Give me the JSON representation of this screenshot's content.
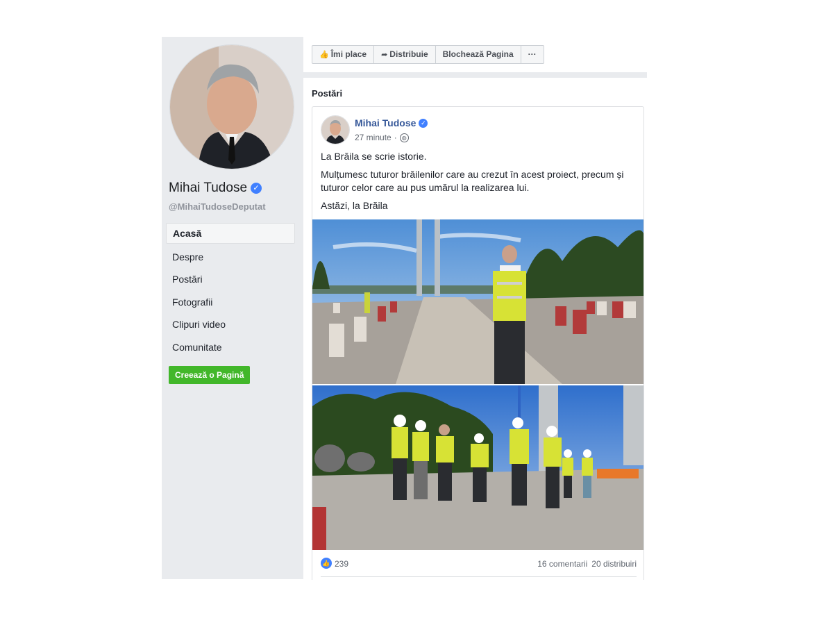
{
  "sidebar": {
    "page_name": "Mihai Tudose",
    "handle": "@MihaiTudoseDeputat",
    "nav": [
      {
        "label": "Acasă"
      },
      {
        "label": "Despre"
      },
      {
        "label": "Postări"
      },
      {
        "label": "Fotografii"
      },
      {
        "label": "Clipuri video"
      },
      {
        "label": "Comunitate"
      }
    ],
    "create_page_label": "Creează o Pagină"
  },
  "actionbar": {
    "like_label": "Îmi place",
    "share_label": "Distribuie",
    "block_label": "Blochează Pagina",
    "more_label": "···"
  },
  "posts": {
    "header": "Postări",
    "post": {
      "author": "Mihai Tudose",
      "time": "27 minute",
      "separator": "·",
      "paragraphs": [
        "La Brăila se scrie istorie.",
        "Mulțumesc tuturor brăilenilor care au crezut în acest proiect, precum și tuturor celor care au pus umărul la realizarea lui.",
        "Astăzi, la Brăila"
      ],
      "likes": "239",
      "comments": "16 comentarii",
      "shares": "20 distribuiri"
    }
  },
  "icons": {
    "verified": "verified-badge-icon",
    "like": "thumbs-up-icon",
    "share": "share-arrow-icon",
    "globe": "globe-icon"
  },
  "colors": {
    "link_blue": "#365899",
    "verified_blue": "#4080ff",
    "create_green": "#42b72a",
    "sidebar_bg": "#e9ebee"
  }
}
